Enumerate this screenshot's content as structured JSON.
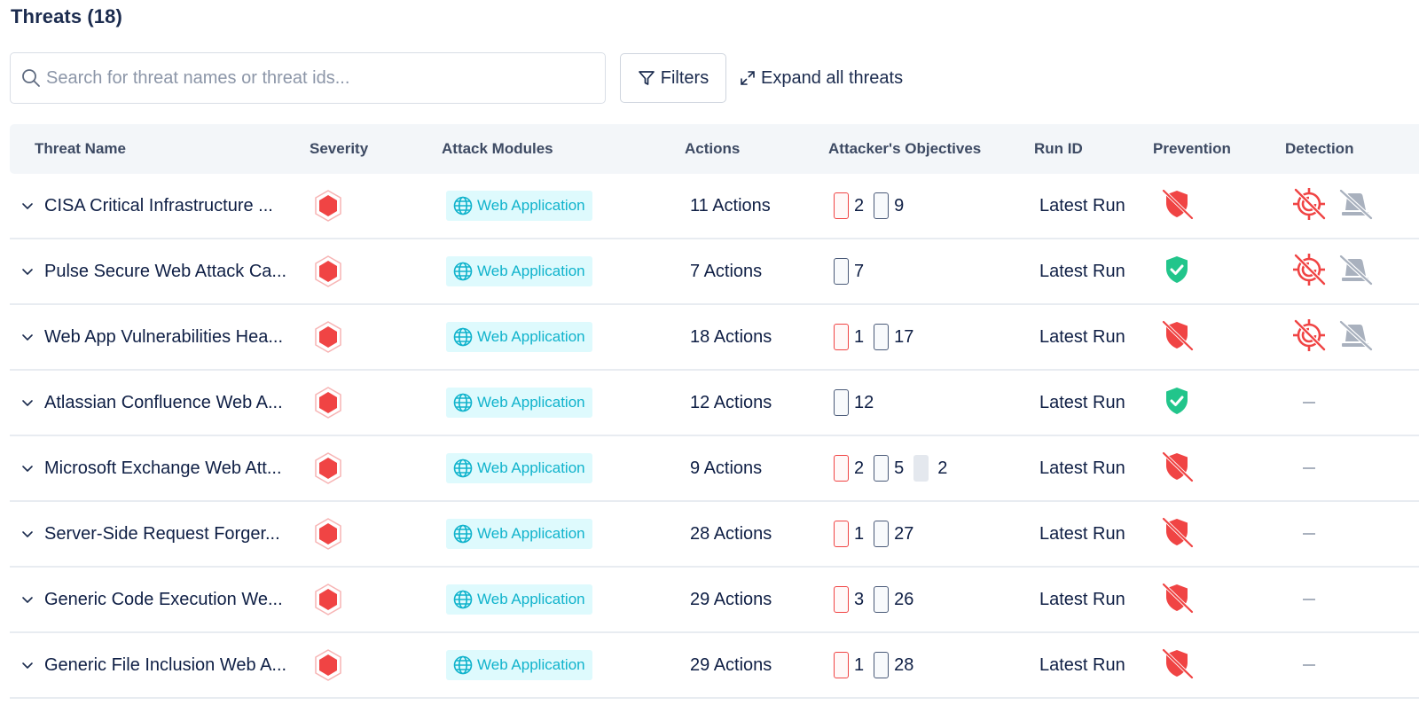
{
  "header": {
    "title": "Threats (18)"
  },
  "toolbar": {
    "search_placeholder": "Search for threat names or threat ids...",
    "search_value": "",
    "filters_label": "Filters",
    "expand_label": "Expand all threats"
  },
  "colors": {
    "critical": "#f04444",
    "safe": "#22c58b",
    "module_bg": "#defafd",
    "module_text": "#10b3cc",
    "muted_icon": "#a9b1be"
  },
  "table": {
    "columns": {
      "name": "Threat Name",
      "severity": "Severity",
      "modules": "Attack Modules",
      "actions": "Actions",
      "objectives": "Attacker's Objectives",
      "run_id": "Run ID",
      "prevention": "Prevention",
      "detection": "Detection"
    },
    "rows": [
      {
        "name": "CISA Critical Infrastructure ...",
        "severity": "critical",
        "module": "Web Application",
        "actions": "11 Actions",
        "objectives": [
          {
            "type": "red",
            "count": "2"
          },
          {
            "type": "blue",
            "count": "9"
          }
        ],
        "run_id": "Latest Run",
        "prevention": "not-prevented",
        "detection": "not-detected"
      },
      {
        "name": "Pulse Secure Web Attack Ca...",
        "severity": "critical",
        "module": "Web Application",
        "actions": "7 Actions",
        "objectives": [
          {
            "type": "blue",
            "count": "7"
          }
        ],
        "run_id": "Latest Run",
        "prevention": "prevented",
        "detection": "not-detected"
      },
      {
        "name": "Web App Vulnerabilities Hea...",
        "severity": "critical",
        "module": "Web Application",
        "actions": "18 Actions",
        "objectives": [
          {
            "type": "red",
            "count": "1"
          },
          {
            "type": "blue",
            "count": "17"
          }
        ],
        "run_id": "Latest Run",
        "prevention": "not-prevented",
        "detection": "not-detected"
      },
      {
        "name": "Atlassian Confluence Web A...",
        "severity": "critical",
        "module": "Web Application",
        "actions": "12 Actions",
        "objectives": [
          {
            "type": "blue",
            "count": "12"
          }
        ],
        "run_id": "Latest Run",
        "prevention": "prevented",
        "detection": "none"
      },
      {
        "name": "Microsoft Exchange Web Att...",
        "severity": "critical",
        "module": "Web Application",
        "actions": "9 Actions",
        "objectives": [
          {
            "type": "red",
            "count": "2"
          },
          {
            "type": "blue",
            "count": "5"
          },
          {
            "type": "grey",
            "count": "2"
          }
        ],
        "run_id": "Latest Run",
        "prevention": "not-prevented",
        "detection": "none"
      },
      {
        "name": "Server-Side Request Forger...",
        "severity": "critical",
        "module": "Web Application",
        "actions": "28 Actions",
        "objectives": [
          {
            "type": "red",
            "count": "1"
          },
          {
            "type": "blue",
            "count": "27"
          }
        ],
        "run_id": "Latest Run",
        "prevention": "not-prevented",
        "detection": "none"
      },
      {
        "name": "Generic Code Execution We...",
        "severity": "critical",
        "module": "Web Application",
        "actions": "29 Actions",
        "objectives": [
          {
            "type": "red",
            "count": "3"
          },
          {
            "type": "blue",
            "count": "26"
          }
        ],
        "run_id": "Latest Run",
        "prevention": "not-prevented",
        "detection": "none"
      },
      {
        "name": "Generic File Inclusion Web A...",
        "severity": "critical",
        "module": "Web Application",
        "actions": "29 Actions",
        "objectives": [
          {
            "type": "red",
            "count": "1"
          },
          {
            "type": "blue",
            "count": "28"
          }
        ],
        "run_id": "Latest Run",
        "prevention": "not-prevented",
        "detection": "none"
      }
    ]
  }
}
